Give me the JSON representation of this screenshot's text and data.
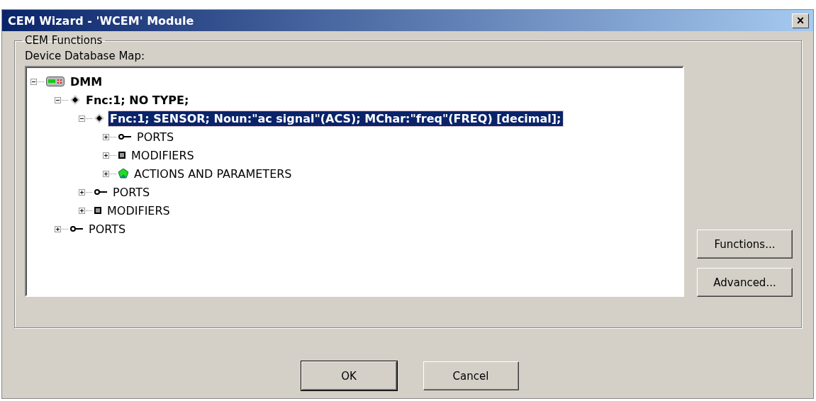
{
  "window": {
    "title": "CEM Wizard - 'WCEM' Module",
    "close_label": "×"
  },
  "group": {
    "title": "CEM Functions",
    "tree_label": "Device Database Map:"
  },
  "tree": [
    {
      "label": "DMM",
      "kind": "device",
      "expanded": true,
      "selected": false,
      "children": [
        {
          "label": "Fnc:1; NO TYPE;",
          "kind": "function",
          "expanded": true,
          "selected": false,
          "children": [
            {
              "label": "Fnc:1; SENSOR; Noun:\"ac signal\"(ACS); MChar:\"freq\"(FREQ) [decimal];",
              "kind": "function",
              "expanded": true,
              "selected": true,
              "children": [
                {
                  "label": "PORTS",
                  "kind": "port",
                  "expanded": false,
                  "selected": false
                },
                {
                  "label": "MODIFIERS",
                  "kind": "modifier",
                  "expanded": false,
                  "selected": false
                },
                {
                  "label": "ACTIONS AND PARAMETERS",
                  "kind": "action",
                  "expanded": false,
                  "selected": false
                }
              ]
            },
            {
              "label": "PORTS",
              "kind": "port",
              "expanded": false,
              "selected": false
            },
            {
              "label": "MODIFIERS",
              "kind": "modifier",
              "expanded": false,
              "selected": false
            }
          ]
        },
        {
          "label": "PORTS",
          "kind": "port",
          "expanded": false,
          "selected": false
        }
      ]
    }
  ],
  "side_buttons": [
    "Functions...",
    "Advanced..."
  ],
  "buttons": [
    {
      "label": "OK",
      "default": true
    },
    {
      "label": "Cancel",
      "default": false
    }
  ]
}
